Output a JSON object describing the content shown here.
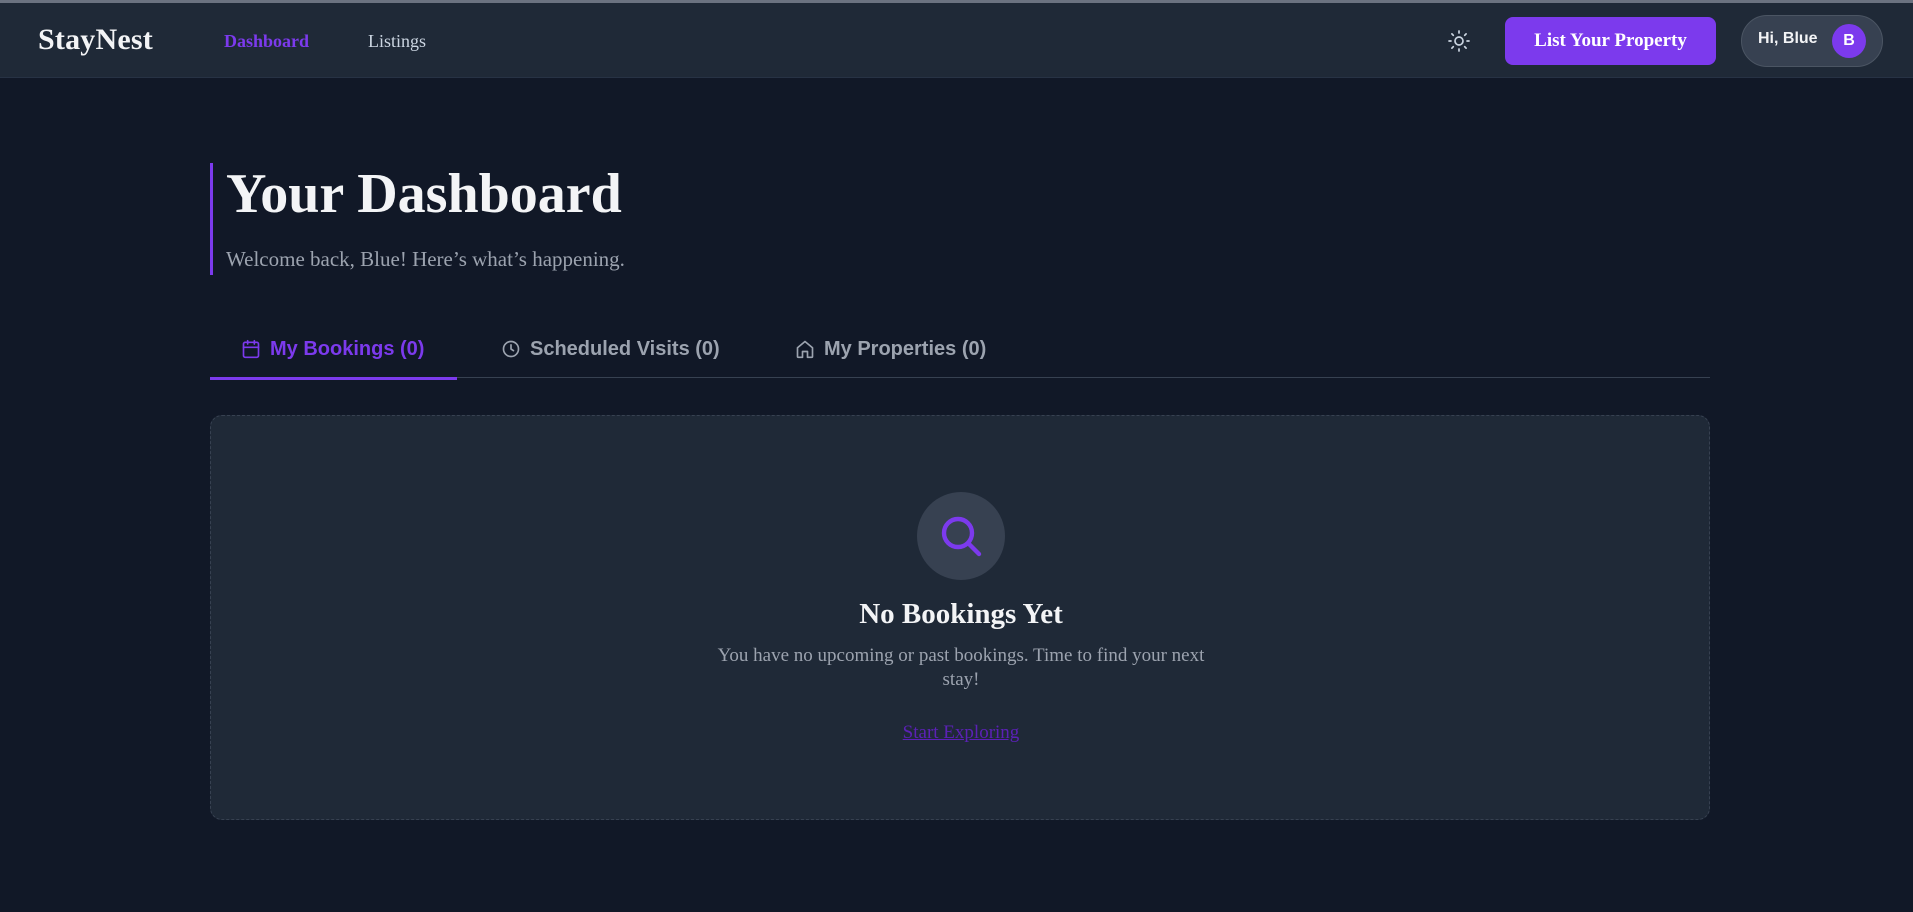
{
  "app": {
    "brand": "StayNest"
  },
  "nav": {
    "links": [
      {
        "label": "Dashboard",
        "active": true
      },
      {
        "label": "Listings",
        "active": false
      }
    ],
    "theme_toggle_icon": "sun-icon",
    "cta_label": "List Your Property",
    "user_greeting": "Hi, Blue",
    "avatar_initial": "B"
  },
  "header": {
    "title": "Your Dashboard",
    "subtitle": "Welcome back, Blue! Here’s what’s happening."
  },
  "tabs": [
    {
      "label": "My Bookings (0)",
      "icon": "calendar-icon",
      "active": true
    },
    {
      "label": "Scheduled Visits (0)",
      "icon": "clock-icon",
      "active": false
    },
    {
      "label": "My Properties (0)",
      "icon": "home-icon",
      "active": false
    }
  ],
  "empty_state": {
    "icon": "search-icon",
    "title": "No Bookings Yet",
    "message": "You have no upcoming or past bookings. Time to find your next stay!",
    "link_label": "Start Exploring"
  },
  "colors": {
    "accent": "#7c3aed",
    "background": "#111827",
    "surface": "#1f2937",
    "muted_text": "#9ca3af"
  }
}
